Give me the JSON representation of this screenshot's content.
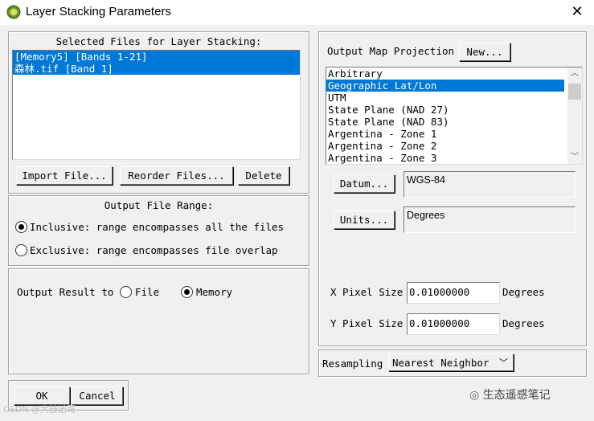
{
  "window": {
    "title": "Layer Stacking Parameters"
  },
  "files": {
    "label": "Selected Files for Layer Stacking:",
    "items": [
      "[Memory5] [Bands 1-21]",
      "森林.tif [Band 1]"
    ],
    "import_label": "Import File...",
    "reorder_label": "Reorder Files...",
    "delete_label": "Delete"
  },
  "range": {
    "title": "Output File Range:",
    "inclusive": "Inclusive: range encompasses all the files",
    "exclusive": "Exclusive: range encompasses file overlap",
    "selected": "inclusive"
  },
  "output": {
    "label": "Output Result to",
    "file": "File",
    "memory": "Memory",
    "selected": "memory"
  },
  "projection": {
    "label": "Output Map Projection",
    "new_label": "New...",
    "items": [
      "Arbitrary",
      "Geographic Lat/Lon",
      "UTM",
      "State Plane (NAD 27)",
      "State Plane (NAD 83)",
      "Argentina - Zone 1",
      "Argentina - Zone 2",
      "Argentina - Zone 3"
    ],
    "selected": "Geographic Lat/Lon"
  },
  "datum": {
    "button": "Datum...",
    "value": "WGS-84"
  },
  "units": {
    "button": "Units...",
    "value": "Degrees"
  },
  "pixel": {
    "x_label": "X Pixel Size",
    "x_value": "0.01000000",
    "x_unit": "Degrees",
    "y_label": "Y Pixel Size",
    "y_value": "0.01000000",
    "y_unit": "Degrees"
  },
  "resampling": {
    "label": "Resampling",
    "value": "Nearest Neighbor"
  },
  "buttons": {
    "ok": "OK",
    "cancel": "Cancel"
  },
  "watermark": {
    "left": "CSDN @大鼓诺哥",
    "right": "生态遥感笔记"
  }
}
